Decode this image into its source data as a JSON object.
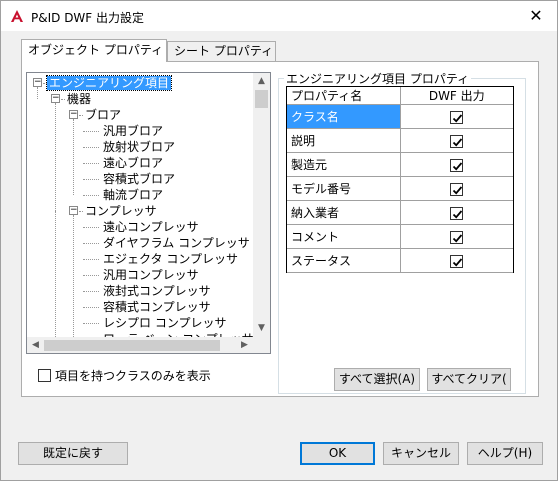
{
  "window": {
    "title": "P&ID DWF 出力設定",
    "close_glyph": "✕"
  },
  "tabs": [
    {
      "label": "オブジェクト プロパティ",
      "active": true
    },
    {
      "label": "シート プロパティ",
      "active": false
    }
  ],
  "tree": [
    {
      "label": "エンジニアリング項目",
      "level": 0,
      "expander": "−",
      "selected": true
    },
    {
      "label": "機器",
      "level": 1,
      "expander": "−"
    },
    {
      "label": "ブロア",
      "level": 2,
      "expander": "−"
    },
    {
      "label": "汎用ブロア",
      "level": 3
    },
    {
      "label": "放射状ブロア",
      "level": 3
    },
    {
      "label": "遠心ブロア",
      "level": 3
    },
    {
      "label": "容積式ブロア",
      "level": 3
    },
    {
      "label": "軸流ブロア",
      "level": 3
    },
    {
      "label": "コンプレッサ",
      "level": 2,
      "expander": "−"
    },
    {
      "label": "遠心コンプレッサ",
      "level": 3
    },
    {
      "label": "ダイヤフラム コンプレッサ",
      "level": 3
    },
    {
      "label": "エジェクタ コンプレッサ",
      "level": 3
    },
    {
      "label": "汎用コンプレッサ",
      "level": 3
    },
    {
      "label": "液封式コンプレッサ",
      "level": 3
    },
    {
      "label": "容積式コンプレッサ",
      "level": 3
    },
    {
      "label": "レシプロ コンプレッサ",
      "level": 3
    },
    {
      "label": "ローラ ベーン コンプレッサ",
      "level": 3
    }
  ],
  "scroll": {
    "up": "▲",
    "down": "▼",
    "left": "◀",
    "right": "▶"
  },
  "filter_checkbox": {
    "label": "項目を持つクラスのみを表示",
    "checked": false
  },
  "group": {
    "title": "エンジニアリング項目 プロパティ",
    "col_property": "プロパティ名",
    "col_dwf": "DWF 出力",
    "rows": [
      {
        "name": "クラス名",
        "checked": true,
        "selected": true
      },
      {
        "name": "説明",
        "checked": true
      },
      {
        "name": "製造元",
        "checked": true
      },
      {
        "name": "モデル番号",
        "checked": true
      },
      {
        "name": "納入業者",
        "checked": true
      },
      {
        "name": "コメント",
        "checked": true
      },
      {
        "name": "ステータス",
        "checked": true
      }
    ],
    "select_all": "すべて選択(A)",
    "clear_all": "すべてクリア("
  },
  "footer": {
    "reset": "既定に戻す",
    "ok": "OK",
    "cancel": "キャンセル",
    "help": "ヘルプ(H)"
  },
  "colors": {
    "accent": "#3399ff",
    "brand_icon": "#c8102e"
  }
}
